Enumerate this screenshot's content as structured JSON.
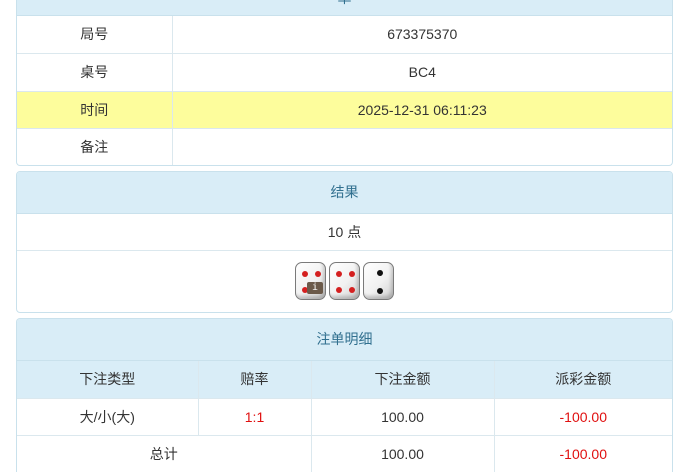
{
  "info": {
    "header": "单",
    "rows": [
      {
        "label": "局号",
        "value": "673375370",
        "highlight": false
      },
      {
        "label": "桌号",
        "value": "BC4",
        "highlight": false
      },
      {
        "label": "时间",
        "value": "2025-12-31 06:11:23",
        "highlight": true
      },
      {
        "label": "备注",
        "value": "",
        "highlight": false
      }
    ]
  },
  "result": {
    "header": "结果",
    "points_text": "10 点",
    "dice": [
      4,
      4,
      2
    ],
    "dice_pip_colors": {
      "4": "#d42020",
      "2": "#111111"
    },
    "badge_icon": "info-icon",
    "badge_text": "i"
  },
  "bets": {
    "header": "注单明细",
    "columns": [
      "下注类型",
      "赔率",
      "下注金额",
      "派彩金额"
    ],
    "rows": [
      {
        "type": "大/小(大)",
        "odds": "1:1",
        "amount": "100.00",
        "payout": "-100.00"
      }
    ],
    "total": {
      "label": "总计",
      "amount": "100.00",
      "payout": "-100.00"
    }
  },
  "colors": {
    "negative": "#e01010",
    "highlight_row": "#fdfd9c",
    "panel_header": "#d9edf7"
  }
}
